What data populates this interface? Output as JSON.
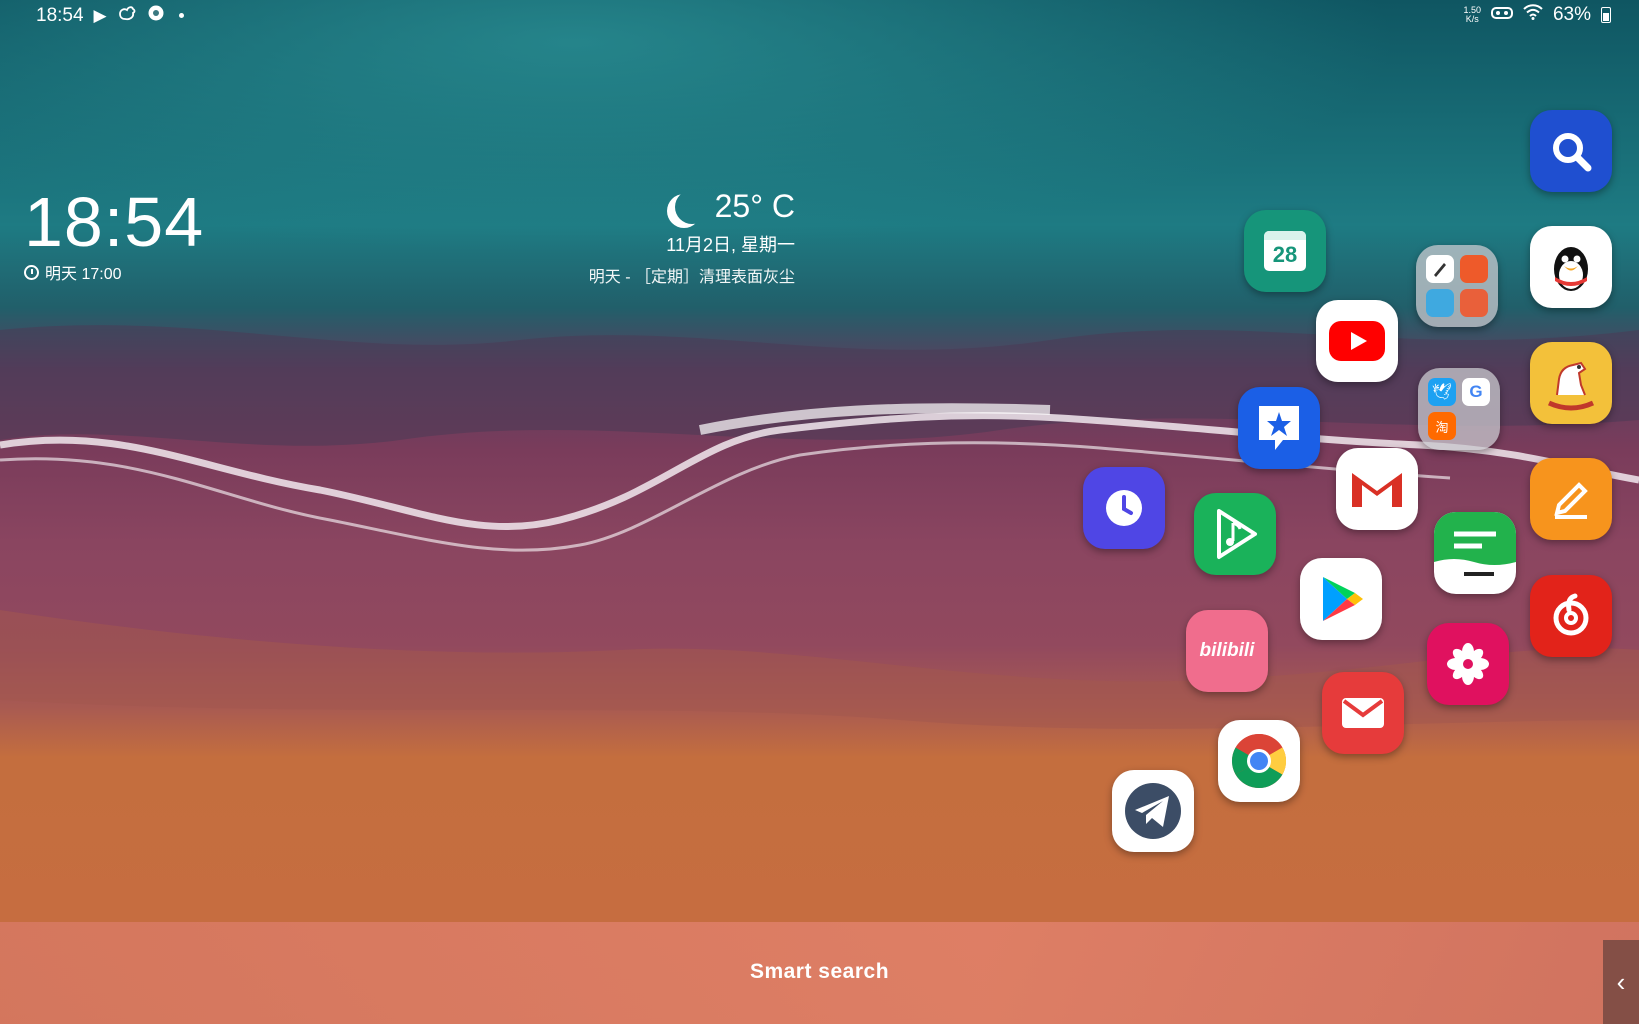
{
  "status_bar": {
    "time": "18:54",
    "net_speed": "1.50\nK/s",
    "battery": "63%"
  },
  "clock_widget": {
    "time": "18:54",
    "alarm": "明天 17:00"
  },
  "weather_widget": {
    "temperature": "25° C",
    "date": "11月2日, 星期一",
    "schedule": "明天 - ［定期］清理表面灰尘"
  },
  "calendar_app": {
    "day": "28"
  },
  "bilibili_app": {
    "label": "bilibili"
  },
  "bottom_bar": {
    "label": "Smart search",
    "handle_glyph": "‹"
  },
  "colors": {
    "sea_deep": "#0d4a56",
    "sea_teal": "#1f7a82",
    "shore_magenta": "#7a3e5c",
    "sand": "#c8703f",
    "search_bar": "#d87a62"
  }
}
